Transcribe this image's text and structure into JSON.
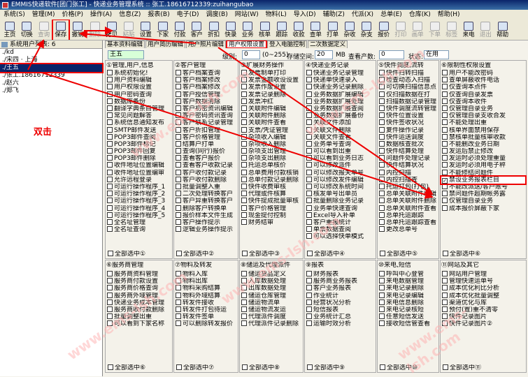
{
  "title": "EMMIS快递软件[团门张工] - 快递业务管理系统 :: 张工.18616712339:zuihangubao",
  "menu": [
    "系统(S)",
    "管理(M)",
    "价格(P)",
    "操作(A)",
    "信息(Z)",
    "报表(B)",
    "电子(D)",
    "调度(B)",
    "网站(W)",
    "物料(L)",
    "导入(D)",
    "辅助(Z)",
    "代派(X)",
    "总单(E)",
    "仓库(K)",
    "帮助(H)"
  ],
  "toolbar": [
    "主页",
    "切换",
    "查询",
    "保存",
    "撤销",
    "删除",
    "拷贝",
    "粘贴",
    "设置",
    "下家",
    "付款",
    "客户",
    "折扣",
    "快录",
    "业务",
    "核单",
    "跟踪",
    "收款",
    "查单",
    "打单",
    "杂收",
    "杂支",
    "报价",
    "打印",
    "画单",
    "下单",
    "标签",
    "来电",
    "退出",
    "帮助"
  ],
  "left": {
    "header": "系统用户列表: 6",
    "users": [
      "./kd",
      "./宋四 · 上海",
      "./王五",
      "./张工.18616712339",
      "./赵六",
      "./郑飞"
    ],
    "annotation": "双击"
  },
  "tabs": [
    "基本资料编辑",
    "用户简历编辑",
    "用户照片编辑",
    "用户权限设置",
    "登入电脑控制",
    "二次数据定义"
  ],
  "filter": {
    "name": "王五",
    "level_label": "级别:",
    "level": "0",
    "range": "(0~255)",
    "space_label": "存储空间:",
    "space": "20",
    "unit": "MB",
    "count_label": "查看产数:",
    "count": "0",
    "status_label": "状态:",
    "status": "在用"
  },
  "panels": [
    {
      "title": "①管理,用户,信息",
      "items": [
        "系统初始化!",
        "用户资料编辑",
        "用户权限设置",
        "用户密码查询",
        "数据库备份",
        "翻译字典条目管理",
        "常见问题解答",
        "系统信息通知发布",
        "SMTP邮件发送",
        "POP3邮件查阅",
        "POP3邮件标记",
        "POP3邮件回复",
        "POP3邮件删除",
        "收件地址位置编辑",
        "收件地址位置编审",
        "允许远程登录",
        "可运行操作程序_1",
        "可运行操作程序_2",
        "可运行操作程序_3",
        "可运行操作程序_4",
        "可运行操作程序_5",
        "全名址管理",
        "全名址查询"
      ],
      "footer": "全部选中①"
    },
    {
      "title": "②客户管理",
      "items": [
        "客户档案查询",
        "客户档案修改",
        "客户档案修改",
        "客户授信管理",
        "客户数据清除",
        "客户初密资讯编辑",
        "客户密码资讯查询",
        "客户联系记录管理",
        "客户折扣管理",
        "客户价格管理",
        "结算户打单",
        "查询(同行)报价",
        "查看客户报价",
        "查看客户收款记录",
        "客户收付款记录",
        "客户收付款删除",
        "批量调整入重",
        "二次处理转换客户",
        "客户异重转换客户",
        "删除客户转换单",
        "报价样本文件生成",
        "客户操作提示",
        "逻辑业务操作提示"
      ],
      "footer": "全部选中②"
    },
    {
      "title": "③扩展财务操作",
      "items": [
        "发票制单打印",
        "发票金额收设设置",
        "发票作废设置",
        "发票记录删除",
        "发票冲红",
        "关联附件编辑",
        "关联附件删除",
        "关联附件查看",
        "支票/凭证管理",
        "杂项收入编辑",
        "杂项收入删除",
        "杂项支出管理",
        "杂项支出删除",
        "托运总单核价",
        "总单费用付款核销",
        "总单付款记录删除",
        "快件收费审核",
        "代理或件核算",
        "快件提成批量审核",
        "客户价格管理",
        "现金提付控制",
        "财务结审"
      ],
      "footer": "全部选中③"
    },
    {
      "title": "④快递业务记录",
      "items": [
        "快递业务记录管理",
        "快递单快速录入",
        "快递业务记录删除",
        "业务数据扩展编辑",
        "业务数据扩展处理",
        "业务数据扩展查阅",
        "业务数据扩展备份",
        "关联文件添加",
        "关联文件删除",
        "关联文件查看",
        "业务单号查询",
        "可以看到出重",
        "可以看到业务日志",
        "可以修改派件",
        "可以修改报关单号",
        "可以修改发件编辑",
        "可以修改系统时间",
        "核发单号出单员",
        "批量删除业务记录",
        "业务单快速查询",
        "Excel导入补单",
        "客户重报统计",
        "单票数据查阅",
        "可以选择快单模式"
      ],
      "footer": "全部选中④"
    },
    {
      "title": "⑤快件调度,流转",
      "items": [
        "快件扫转扫描",
        "检查动态入扫描",
        "可切换扫描信息点",
        "仅扫描数据在打",
        "扫描数据记录管理",
        "快件调度流转管理",
        "快件位置设置",
        "快件签收状况",
        "复件操作记录",
        "快件运送调度",
        "数据核查批次",
        "快件结算处理",
        "问题件处理记录",
        "快件结算状况",
        "内控扫描",
        "内控扫描查",
        "托运打包(打包)",
        "总单关联附件编辑",
        "总单关联附件删除",
        "总单关联附件查看",
        "总单托运跟踪",
        "总单托运跟踪查看",
        "更改总单号"
      ],
      "footer": "全部选中⑤"
    },
    {
      "title": "⑥限制性权限设置",
      "items": [
        "用户不能改密码",
        "查单屏蔽收件电话",
        "仅查询本点件",
        "仅查询自录发票",
        "仅查询本收件",
        "仅管理自录业务",
        "仅管理自录支收合发",
        "不能处理出重",
        "核单界面禁用保存",
        "禁核单批量核审收款",
        "不能删改业务日期",
        "发运后禁止修改",
        "发运时必须处理重量",
        "发运时必须用电子秤",
        "不能修结问题件",
        "禁设业务报表栏目",
        "不能改派送/客户账号",
        "禁问题件超期帐务露",
        "仅管理自录业务",
        "成本报价屏蔽下家"
      ],
      "footer": "全部选中⑥"
    },
    {
      "title": "⑥服务商管理",
      "items": [
        "服务商资料管理",
        "服务商付款设置",
        "服务商价格查询",
        "服务商外域管理",
        "快递业务成本管理",
        "服务商收付款删除",
        "批量调整出重",
        "可以看到下家名称"
      ],
      "footer": "全部选中⑥"
    },
    {
      "title": "⑦物料及转发",
      "items": [
        "物料入库",
        "物料出库",
        "物料采购结算",
        "物料外域结算",
        "转发件接收",
        "转发件打包待运",
        "转发件签单",
        "可以删除转发报价"
      ],
      "footer": "全部选中⑦"
    },
    {
      "title": "⑧储运及代理派件",
      "items": [
        "储运货品定义",
        "入库数据处理",
        "出库数据处理",
        "储运仓库管理",
        "储运物流单",
        "储运物流发运",
        "代理派件调度",
        "代理派件记录删除"
      ],
      "footer": "全部选中⑧"
    },
    {
      "title": "⑨报表",
      "items": [
        "财务报表",
        "服务商业务报表",
        "客户业务报表",
        "作业统计",
        "经营状况分析",
        "短信报表",
        "业务统计汇总",
        "运输时效分析"
      ],
      "footer": "全部选中⑨"
    },
    {
      "title": "⑩来电,短信",
      "items": [
        "呼叫中心登管",
        "来电数据管理",
        "来电记录删除",
        "来电记录编辑",
        "来电信息删除",
        "来电记录核短",
        "任意短信发送",
        "接收短信管查看"
      ],
      "footer": "全部选中⑩"
    },
    {
      "title": "⑪网站及其它",
      "items": [
        "网站用户管理",
        "管理快速运单号",
        "成本优化利比分析",
        "成本优化批量调整",
        "渠道优化与库",
        "预付(置)重不清零",
        "快件记录图片",
        "快件记录图片②"
      ],
      "footer": "全部选中⑪"
    }
  ],
  "checked_item": "禁设业务报表栏目",
  "watermark": "www.ems-lsh.com",
  "colors": {
    "accent": "#e00000",
    "selection": "#0a246a"
  }
}
